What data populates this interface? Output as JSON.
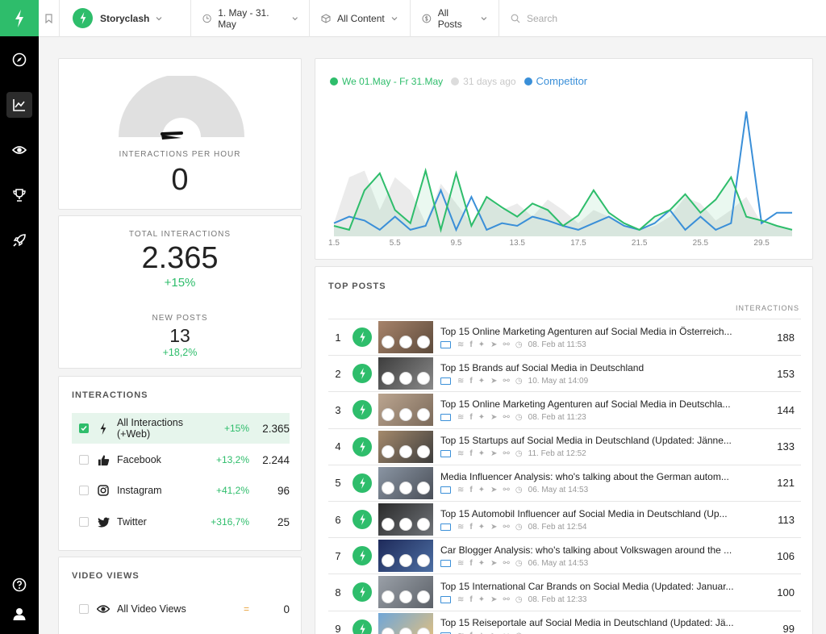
{
  "topbar": {
    "brand": "Storyclash",
    "date_range": "1. May - 31. May",
    "content_filter": "All Content",
    "posts_filter": "All Posts",
    "search_placeholder": "Search"
  },
  "gauge": {
    "label": "INTERACTIONS PER HOUR",
    "value": "0"
  },
  "totals": {
    "total_label": "TOTAL INTERACTIONS",
    "total_value": "2.365",
    "total_change": "+15%",
    "new_posts_label": "NEW POSTS",
    "new_posts_value": "13",
    "new_posts_change": "+18,2%"
  },
  "interactions": {
    "title": "INTERACTIONS",
    "rows": [
      {
        "name": "All Interactions (+Web)",
        "change": "+15%",
        "value": "2.365"
      },
      {
        "name": "Facebook",
        "change": "+13,2%",
        "value": "2.244"
      },
      {
        "name": "Instagram",
        "change": "+41,2%",
        "value": "96"
      },
      {
        "name": "Twitter",
        "change": "+316,7%",
        "value": "25"
      }
    ]
  },
  "video_views": {
    "title": "VIDEO VIEWS",
    "rows": [
      {
        "name": "All Video Views",
        "change": "=",
        "value": "0"
      }
    ]
  },
  "colors": {
    "accent": "#2ebd6b",
    "competitor": "#3a8fd8",
    "previous": "#dcdcdc"
  },
  "chart_data": {
    "type": "line",
    "legend": [
      "We 01.May - Fr 31.May",
      "31 days ago",
      "Competitor"
    ],
    "x_ticks": [
      "1.5",
      "5.5",
      "9.5",
      "13.5",
      "17.5",
      "21.5",
      "25.5",
      "29.5"
    ],
    "x": [
      1,
      2,
      3,
      4,
      5,
      6,
      7,
      8,
      9,
      10,
      11,
      12,
      13,
      14,
      15,
      16,
      17,
      18,
      19,
      20,
      21,
      22,
      23,
      24,
      25,
      26,
      27,
      28,
      29,
      30,
      31
    ],
    "ylim": [
      0,
      100
    ],
    "series": [
      {
        "name": "We 01.May - Fr 31.May",
        "values": [
          8,
          5,
          35,
          48,
          20,
          10,
          50,
          5,
          48,
          8,
          30,
          22,
          15,
          25,
          20,
          8,
          16,
          35,
          18,
          10,
          5,
          15,
          20,
          32,
          18,
          28,
          45,
          15,
          12,
          8,
          5
        ]
      },
      {
        "name": "31 days ago",
        "values": [
          10,
          45,
          50,
          20,
          45,
          35,
          10,
          40,
          25,
          10,
          30,
          20,
          25,
          15,
          28,
          20,
          10,
          20,
          15,
          8,
          5,
          8,
          15,
          30,
          25,
          12,
          20,
          30,
          10,
          8,
          5
        ]
      },
      {
        "name": "Competitor",
        "values": [
          10,
          15,
          12,
          5,
          15,
          5,
          8,
          35,
          5,
          30,
          5,
          10,
          8,
          15,
          12,
          8,
          5,
          10,
          15,
          8,
          5,
          10,
          20,
          5,
          15,
          5,
          10,
          95,
          10,
          18,
          18
        ]
      }
    ]
  },
  "top_posts": {
    "title": "TOP POSTS",
    "col_label": "INTERACTIONS",
    "rows": [
      {
        "rank": "1",
        "title": "Top 15 Online Marketing Agenturen auf Social Media in Österreich...",
        "date": "08. Feb at 11:53",
        "value": "188"
      },
      {
        "rank": "2",
        "title": "Top 15 Brands auf Social Media in Deutschland",
        "date": "10. May at 14:09",
        "value": "153"
      },
      {
        "rank": "3",
        "title": "Top 15 Online Marketing Agenturen auf Social Media in Deutschla...",
        "date": "08. Feb at 11:23",
        "value": "144"
      },
      {
        "rank": "4",
        "title": "Top 15 Startups auf Social Media in Deutschland (Updated: Jänne...",
        "date": "11. Feb at 12:52",
        "value": "133"
      },
      {
        "rank": "5",
        "title": "Media Influencer Analysis: who's talking about the German autom...",
        "date": "06. May at 14:53",
        "value": "121"
      },
      {
        "rank": "6",
        "title": "Top 15 Automobil Influencer auf Social Media in Deutschland (Up...",
        "date": "08. Feb at 12:54",
        "value": "113"
      },
      {
        "rank": "7",
        "title": "Car Blogger Analysis: who's talking about Volkswagen around the ...",
        "date": "06. May at 14:53",
        "value": "106"
      },
      {
        "rank": "8",
        "title": "Top 15 International Car Brands on Social Media (Updated: Januar...",
        "date": "08. Feb at 12:33",
        "value": "100"
      },
      {
        "rank": "9",
        "title": "Top 15 Reiseportale auf Social Media in Deutschland (Updated: Jä...",
        "date": "",
        "value": "99"
      }
    ]
  }
}
